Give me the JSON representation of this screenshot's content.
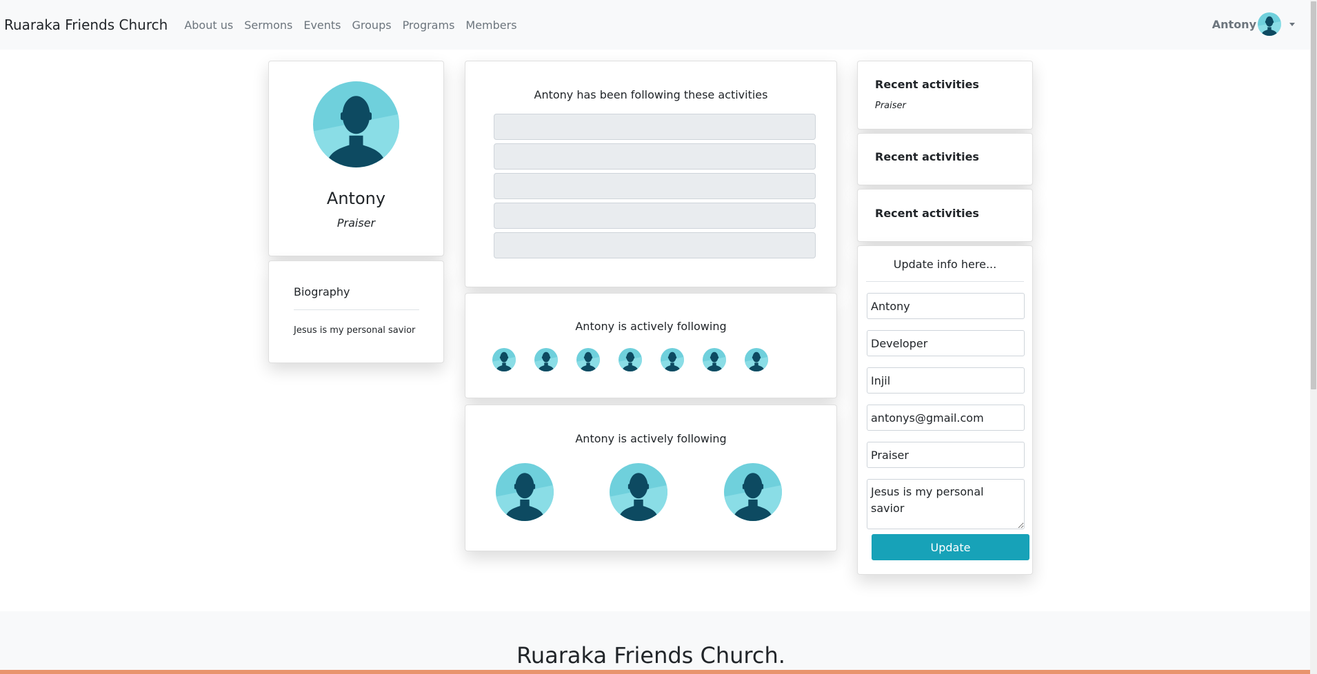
{
  "navbar": {
    "brand": "Ruaraka Friends Church",
    "links": [
      "About us",
      "Sermons",
      "Events",
      "Groups",
      "Programs",
      "Members"
    ],
    "user_name": "Antony"
  },
  "profile": {
    "name": "Antony",
    "role": "Praiser"
  },
  "biography": {
    "title": "Biography",
    "text": "Jesus is my personal savior"
  },
  "activities": {
    "heading": "Antony has been following these activities",
    "item_count": 5
  },
  "following_small": {
    "heading": "Antony is actively following",
    "avatar_count": 7
  },
  "following_large": {
    "heading": "Antony is actively following",
    "avatar_count": 3
  },
  "recent": [
    {
      "title": "Recent activities",
      "subtitle": "Praiser"
    },
    {
      "title": "Recent activities",
      "subtitle": ""
    },
    {
      "title": "Recent activities",
      "subtitle": ""
    }
  ],
  "update_form": {
    "heading": "Update info here...",
    "name": "Antony",
    "occupation": "Developer",
    "church": "Injil",
    "email": "antonys@gmail.com",
    "role": "Praiser",
    "bio": "Jesus is my personal savior",
    "submit_label": "Update"
  },
  "footer": {
    "title": "Ruaraka Friends Church."
  },
  "colors": {
    "accent": "#17a2b8",
    "avatar_bg": "#6fd0dc",
    "avatar_silhouette": "#0d4a61",
    "bottom_strip": "#e8946d"
  },
  "icons": {
    "avatar": "user-silhouette-icon",
    "dropdown": "caret-down-icon"
  }
}
